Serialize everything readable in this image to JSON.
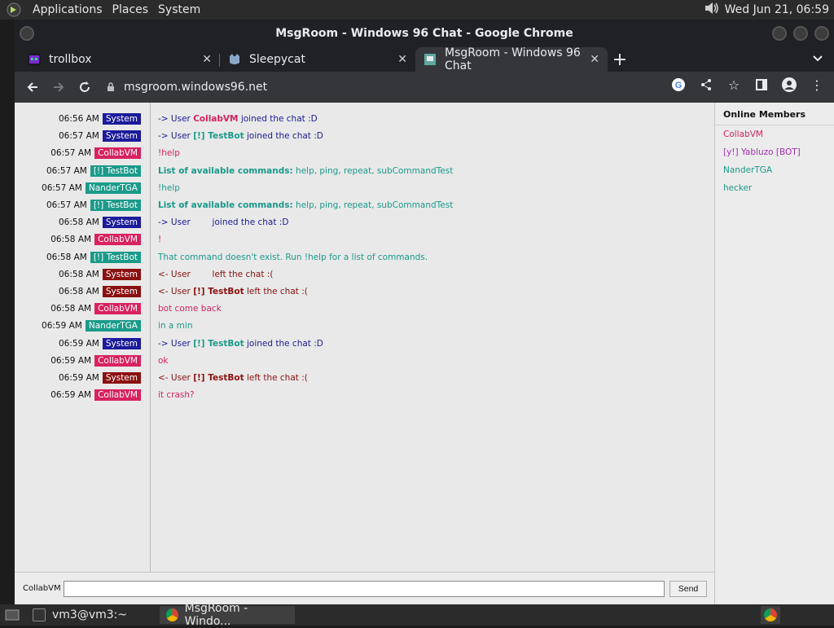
{
  "top_panel": {
    "menus": [
      "Applications",
      "Places",
      "System"
    ],
    "clock": "Wed Jun 21, 06:59"
  },
  "window": {
    "title": "MsgRoom - Windows 96 Chat - Google Chrome",
    "tabs": [
      {
        "label": "trollbox",
        "favicon_color": "#7a2bd6"
      },
      {
        "label": "Sleepycat",
        "favicon_color": "#8aa7c6"
      },
      {
        "label": "MsgRoom - Windows 96 Chat",
        "favicon_color": "#5fa8a0"
      }
    ],
    "url": "msgroom.windows96.net"
  },
  "colors": {
    "system": "#1b1b9b",
    "system_leave": "#8b1010",
    "collabvm": "#d9225f",
    "testbot": "#1b9a8a",
    "nander": "#1b9a8a",
    "system_text": "#1b1b9b",
    "leave_text": "#8b1010"
  },
  "messages": [
    {
      "time": "06:56 AM",
      "user": "System",
      "kind": "system",
      "parts": [
        [
          "-> User ",
          ""
        ],
        [
          "CollabVM",
          "b collab"
        ],
        [
          " joined the chat :D",
          ""
        ]
      ]
    },
    {
      "time": "06:57 AM",
      "user": "System",
      "kind": "system",
      "parts": [
        [
          "-> User ",
          ""
        ],
        [
          "[!] TestBot",
          "b teal"
        ],
        [
          " joined the chat :D",
          ""
        ]
      ]
    },
    {
      "time": "06:57 AM",
      "user": "CollabVM",
      "kind": "collabvm",
      "parts": [
        [
          "!help",
          "collab"
        ]
      ]
    },
    {
      "time": "06:57 AM",
      "user": "[!] TestBot",
      "kind": "testbot",
      "parts": [
        [
          "List of available commands:",
          "b teal"
        ],
        [
          " help, ping, repeat, subCommandTest",
          "teal"
        ]
      ]
    },
    {
      "time": "06:57 AM",
      "user": "NanderTGA",
      "kind": "nander",
      "parts": [
        [
          "!help",
          "teal"
        ]
      ]
    },
    {
      "time": "06:57 AM",
      "user": "[!] TestBot",
      "kind": "testbot",
      "parts": [
        [
          "List of available commands:",
          "b teal"
        ],
        [
          " help, ping, repeat, subCommandTest",
          "teal"
        ]
      ]
    },
    {
      "time": "06:58 AM",
      "user": "System",
      "kind": "system",
      "parts": [
        [
          "-> User        joined the chat :D",
          ""
        ]
      ]
    },
    {
      "time": "06:58 AM",
      "user": "CollabVM",
      "kind": "collabvm",
      "parts": [
        [
          "!",
          "collab"
        ]
      ]
    },
    {
      "time": "06:58 AM",
      "user": "[!] TestBot",
      "kind": "testbot",
      "parts": [
        [
          "That command doesn't exist. Run !help for a list of commands.",
          "teal"
        ]
      ]
    },
    {
      "time": "06:58 AM",
      "user": "System",
      "kind": "system_leave",
      "parts": [
        [
          "<- User        left the chat :(",
          "leave"
        ]
      ]
    },
    {
      "time": "06:58 AM",
      "user": "System",
      "kind": "system_leave",
      "parts": [
        [
          "<- User ",
          "leave"
        ],
        [
          "[!] TestBot",
          "b leave"
        ],
        [
          " left the chat :(",
          "leave"
        ]
      ]
    },
    {
      "time": "06:58 AM",
      "user": "CollabVM",
      "kind": "collabvm",
      "parts": [
        [
          "bot come back",
          "collab"
        ]
      ]
    },
    {
      "time": "06:59 AM",
      "user": "NanderTGA",
      "kind": "nander",
      "parts": [
        [
          "in a min",
          "teal"
        ]
      ]
    },
    {
      "time": "06:59 AM",
      "user": "System",
      "kind": "system",
      "parts": [
        [
          "-> User ",
          ""
        ],
        [
          "[!] TestBot",
          "b teal"
        ],
        [
          " joined the chat :D",
          ""
        ]
      ]
    },
    {
      "time": "06:59 AM",
      "user": "CollabVM",
      "kind": "collabvm",
      "parts": [
        [
          "ok",
          "collab"
        ]
      ]
    },
    {
      "time": "06:59 AM",
      "user": "System",
      "kind": "system_leave",
      "parts": [
        [
          "<- User ",
          "leave"
        ],
        [
          "[!] TestBot",
          "b leave"
        ],
        [
          " left the chat :(",
          "leave"
        ]
      ]
    },
    {
      "time": "06:59 AM",
      "user": "CollabVM",
      "kind": "collabvm",
      "parts": [
        [
          "it crash?",
          "collab"
        ]
      ]
    }
  ],
  "members": {
    "title": "Online Members",
    "list": [
      {
        "name": "CollabVM",
        "color": "#d9225f"
      },
      {
        "name": "[y!] Yabluzo [BOT]",
        "color": "#a030b0"
      },
      {
        "name": "NanderTGA",
        "color": "#1b9a8a"
      },
      {
        "name": "hecker",
        "color": "#1b9a8a"
      }
    ]
  },
  "input": {
    "username": "CollabVM",
    "value": "",
    "send_label": "Send"
  },
  "taskbar": {
    "items": [
      {
        "label": "vm3@vm3:~",
        "icon": "terminal-icon"
      },
      {
        "label": "MsgRoom - Windo...",
        "icon": "chrome-icon"
      }
    ]
  }
}
